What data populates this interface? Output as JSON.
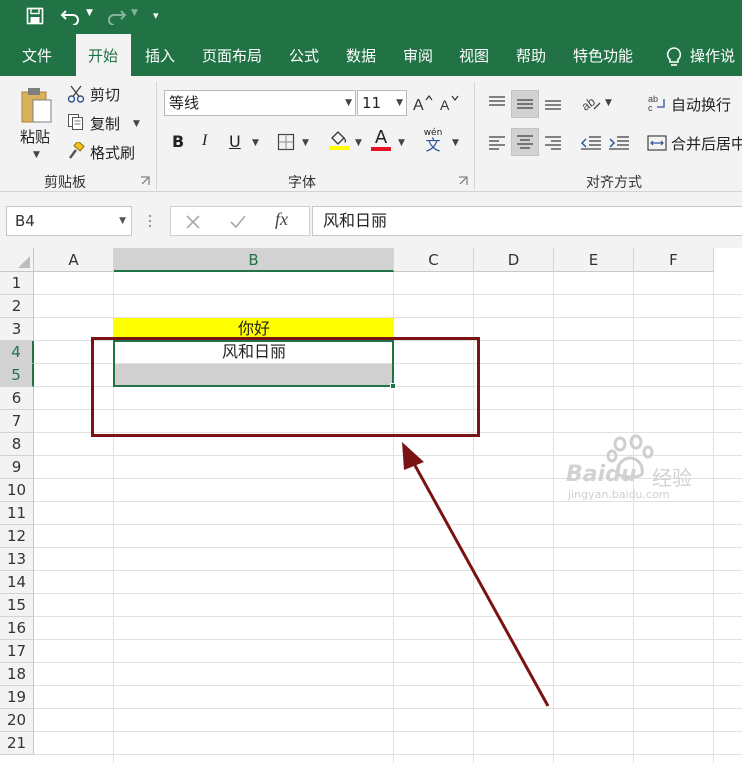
{
  "quick_access": {
    "customize_glyph": "▾"
  },
  "tabs": [
    {
      "label": "文件",
      "active": false
    },
    {
      "label": "开始",
      "active": true
    },
    {
      "label": "插入",
      "active": false
    },
    {
      "label": "页面布局",
      "active": false
    },
    {
      "label": "公式",
      "active": false
    },
    {
      "label": "数据",
      "active": false
    },
    {
      "label": "审阅",
      "active": false
    },
    {
      "label": "视图",
      "active": false
    },
    {
      "label": "帮助",
      "active": false
    },
    {
      "label": "特色功能",
      "active": false
    }
  ],
  "tell_me": "操作说",
  "clipboard": {
    "paste": "粘贴",
    "cut": "剪切",
    "copy": "复制",
    "format_painter": "格式刷",
    "label": "剪贴板"
  },
  "font": {
    "name": "等线",
    "size": "11",
    "bold": "B",
    "italic": "I",
    "underline": "U",
    "font_color_glyph": "A",
    "phonetic_top": "wén",
    "phonetic_bottom": "文",
    "label": "字体",
    "fill_color": "#ffff00",
    "font_color": "#e81123"
  },
  "alignment": {
    "wrap_text": "自动换行",
    "merge_center": "合并后居中",
    "label": "对齐方式"
  },
  "formula_bar": {
    "name_box": "B4",
    "fx": "fx",
    "value": "风和日丽"
  },
  "grid": {
    "columns": [
      "A",
      "B",
      "C",
      "D",
      "E",
      "F"
    ],
    "selected_column": "B",
    "rows": [
      "1",
      "2",
      "3",
      "4",
      "5",
      "6",
      "7",
      "8",
      "9",
      "10",
      "11",
      "12",
      "13",
      "14",
      "15",
      "16",
      "17",
      "18",
      "19",
      "20",
      "21"
    ],
    "selected_rows": [
      "4",
      "5"
    ],
    "cells": {
      "B3": {
        "value": "你好",
        "fill": "#ffff00"
      },
      "B4": {
        "value": "风和日丽"
      },
      "B5": {
        "value": "",
        "fill": "#d0d0d0"
      }
    },
    "accent_color": "#217346"
  },
  "annotation": {
    "color": "#7a1414"
  },
  "watermark": {
    "brand": "Baidu",
    "brand_suffix": "经验",
    "url": "jingyan.baidu.com"
  }
}
